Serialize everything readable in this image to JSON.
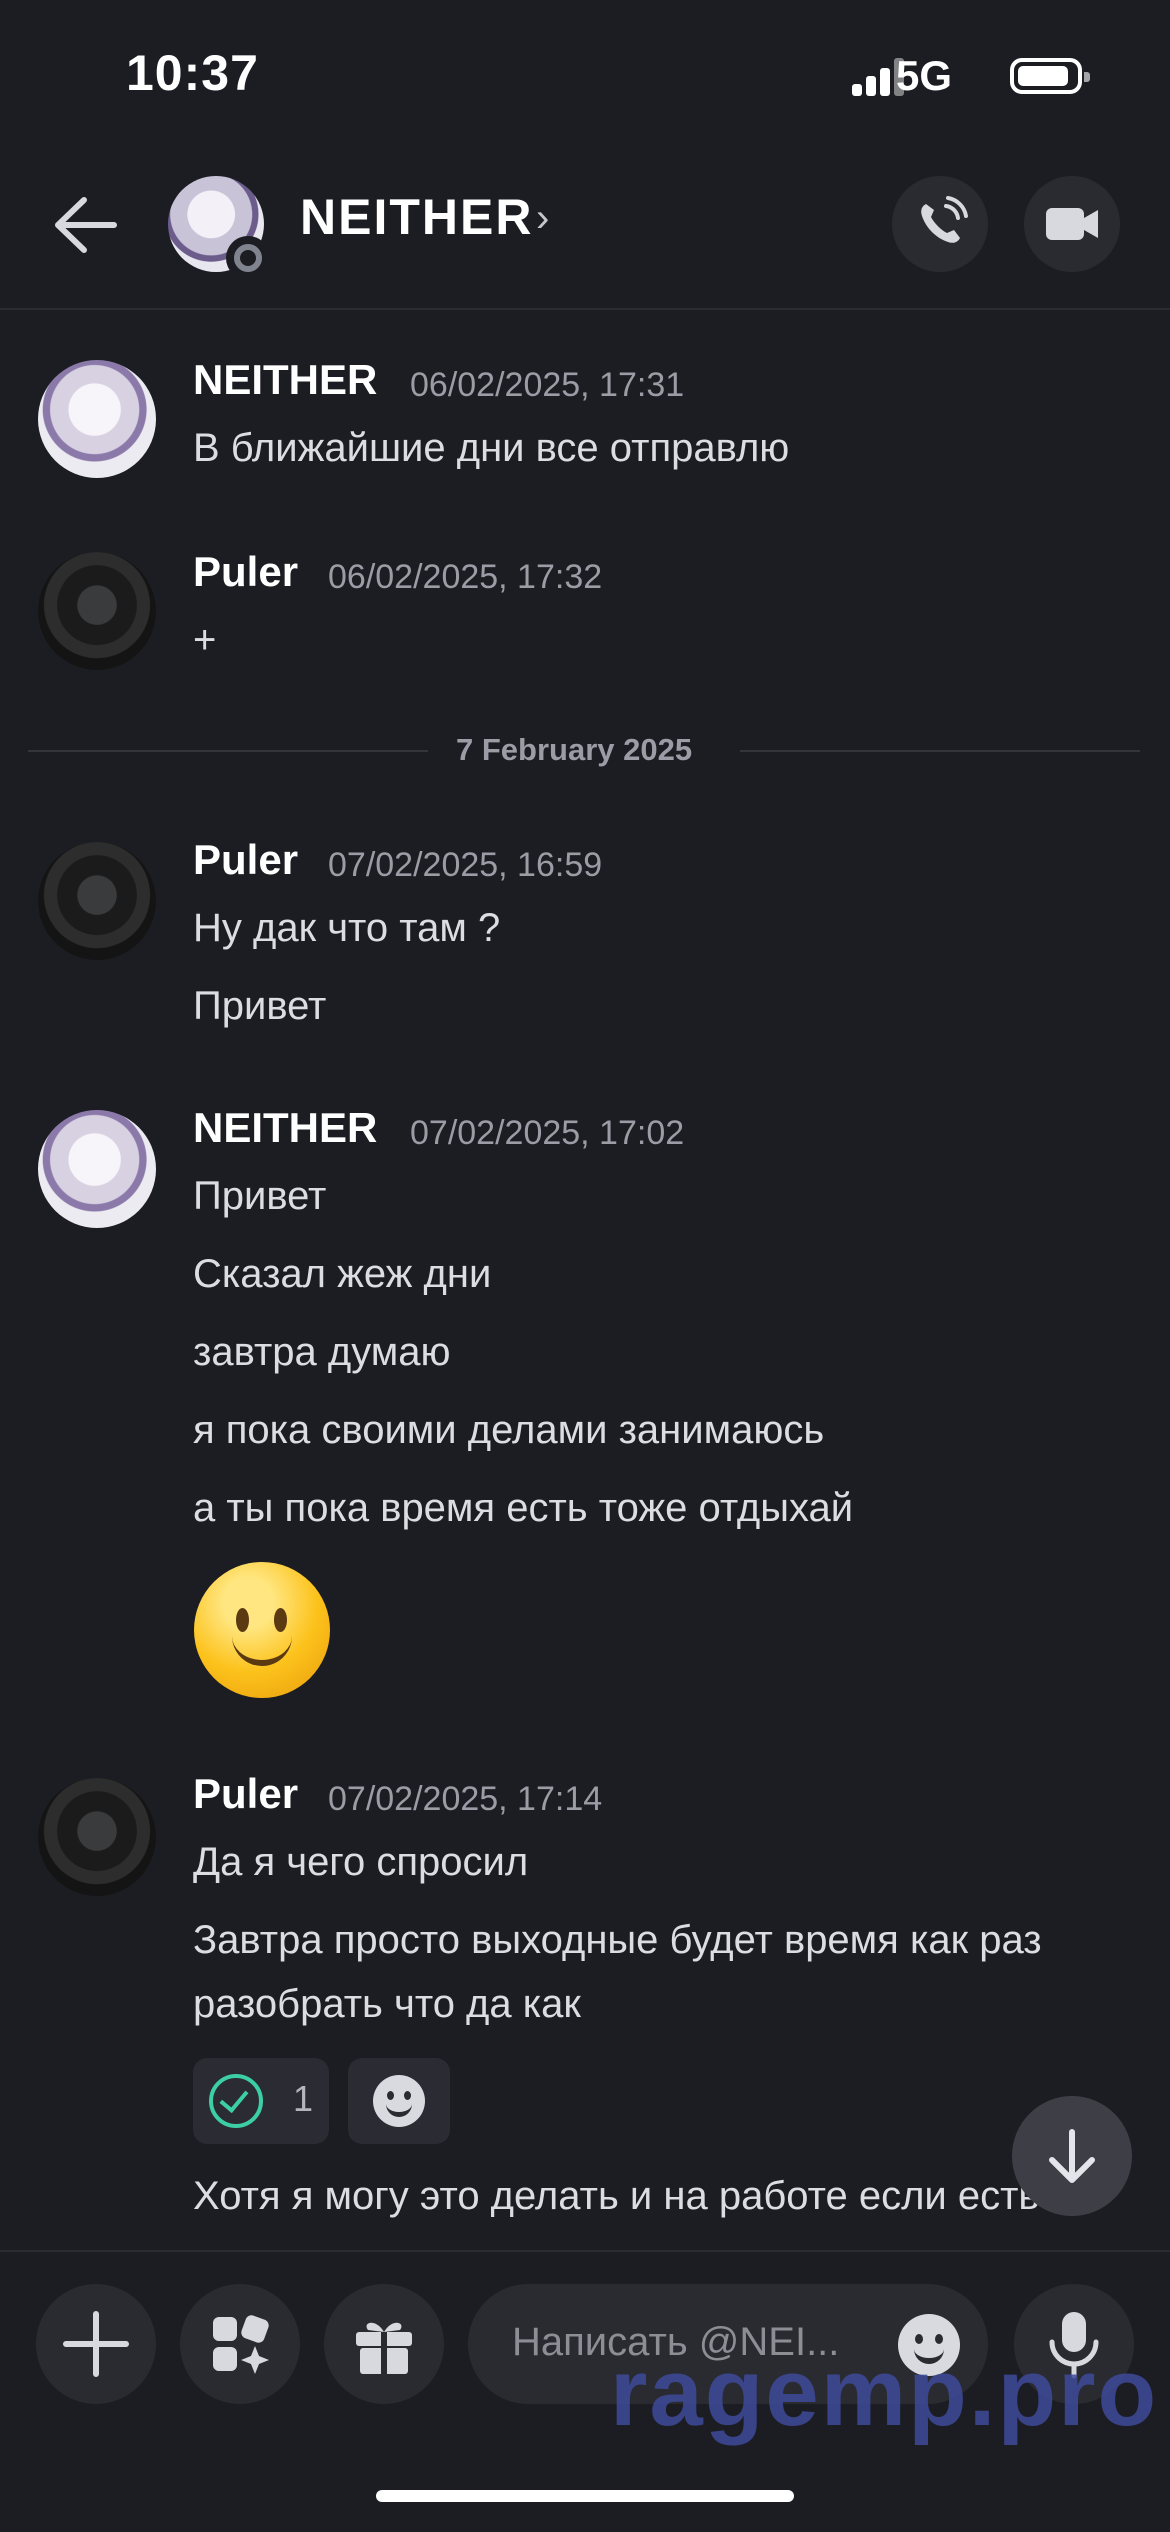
{
  "status_bar": {
    "time": "10:37",
    "network": "5G"
  },
  "header": {
    "contact_name": "NEITHER",
    "chevron": "›"
  },
  "divider": {
    "date": "7 February 2025"
  },
  "messages": [
    {
      "author": "NEITHER",
      "timestamp": "06/02/2025, 17:31",
      "lines": [
        "В ближайшие дни все отправлю"
      ]
    },
    {
      "author": "Puler",
      "timestamp": "06/02/2025, 17:32",
      "lines": [
        "+"
      ]
    },
    {
      "author": "Puler",
      "timestamp": "07/02/2025, 16:59",
      "lines": [
        "Ну дак что там ?",
        "Привет"
      ]
    },
    {
      "author": "NEITHER",
      "timestamp": "07/02/2025, 17:02",
      "lines": [
        "Привет",
        "Сказал жеж дни",
        "завтра думаю",
        "я пока своими делами занимаюсь",
        "а ты пока время есть тоже отдыхай"
      ]
    },
    {
      "author": "Puler",
      "timestamp": "07/02/2025, 17:14",
      "lines": [
        "Да я чего спросил",
        "Завтра просто выходные будет время как раз разобрать что да как",
        "Хотя я могу это делать и на работе если есть"
      ]
    }
  ],
  "reactions": [
    {
      "icon": "check-icon",
      "count": "1"
    }
  ],
  "composer": {
    "placeholder": "Написать @NEI..."
  },
  "watermark": "ragemp.pro",
  "colors": {
    "background": "#1c1d22",
    "accent_check": "#3ccfa5",
    "watermark": "#3f4a9a"
  }
}
